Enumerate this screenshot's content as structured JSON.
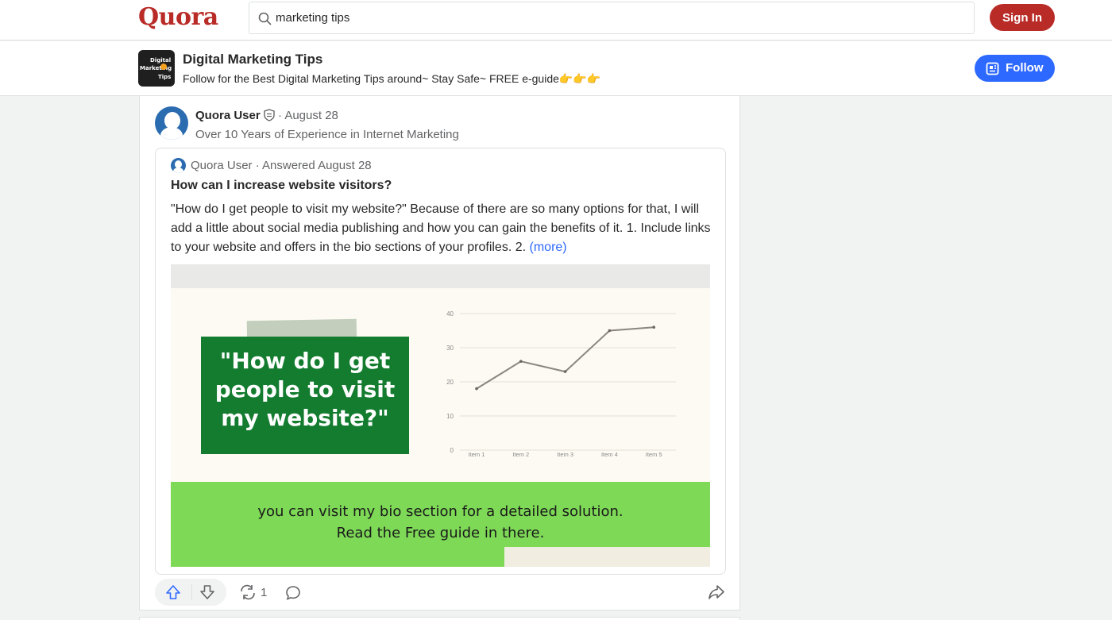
{
  "header": {
    "logo": "Quora",
    "search_value": "marketing tips",
    "signin_label": "Sign In"
  },
  "space": {
    "icon_text": [
      "Digital",
      "Marketing",
      "Tips"
    ],
    "name": "Digital Marketing Tips",
    "description": "Follow for the Best Digital Marketing Tips around~ Stay Safe~ FREE e-guide👉👉👉",
    "follow_label": "Follow"
  },
  "post": {
    "author": "Quora User",
    "date": "· August 28",
    "credential": "Over 10 Years of Experience in Internet Marketing",
    "inner": {
      "author_line": "Quora User · Answered August 28",
      "question": "How can I increase website visitors?",
      "answer_text": "\"How do I get people to visit my website?\" Because of there are so many options for that, I will add a little about social media publishing and how you can gain the benefits of it. 1. Include links to your website and offers in the bio sections of your profiles. 2.",
      "more_label": "(more)"
    },
    "image": {
      "headline_lines": [
        "\"How do I get",
        "people to visit",
        "my website?\""
      ],
      "caption_lines": [
        "you can visit my bio section for a detailed solution.",
        "Read the Free guide in there."
      ]
    },
    "actions": {
      "reshare_count": "1"
    }
  },
  "chart_data": {
    "type": "line",
    "categories": [
      "Item 1",
      "Item 2",
      "Item 3",
      "Item 4",
      "Item 5"
    ],
    "values": [
      18,
      26,
      23,
      35,
      36
    ],
    "ylim": [
      0,
      40
    ],
    "yticks": [
      "0",
      "10",
      "20",
      "30",
      "40"
    ],
    "grid": true,
    "line_color": "#8a8580",
    "title": "",
    "xlabel": "",
    "ylabel": ""
  }
}
